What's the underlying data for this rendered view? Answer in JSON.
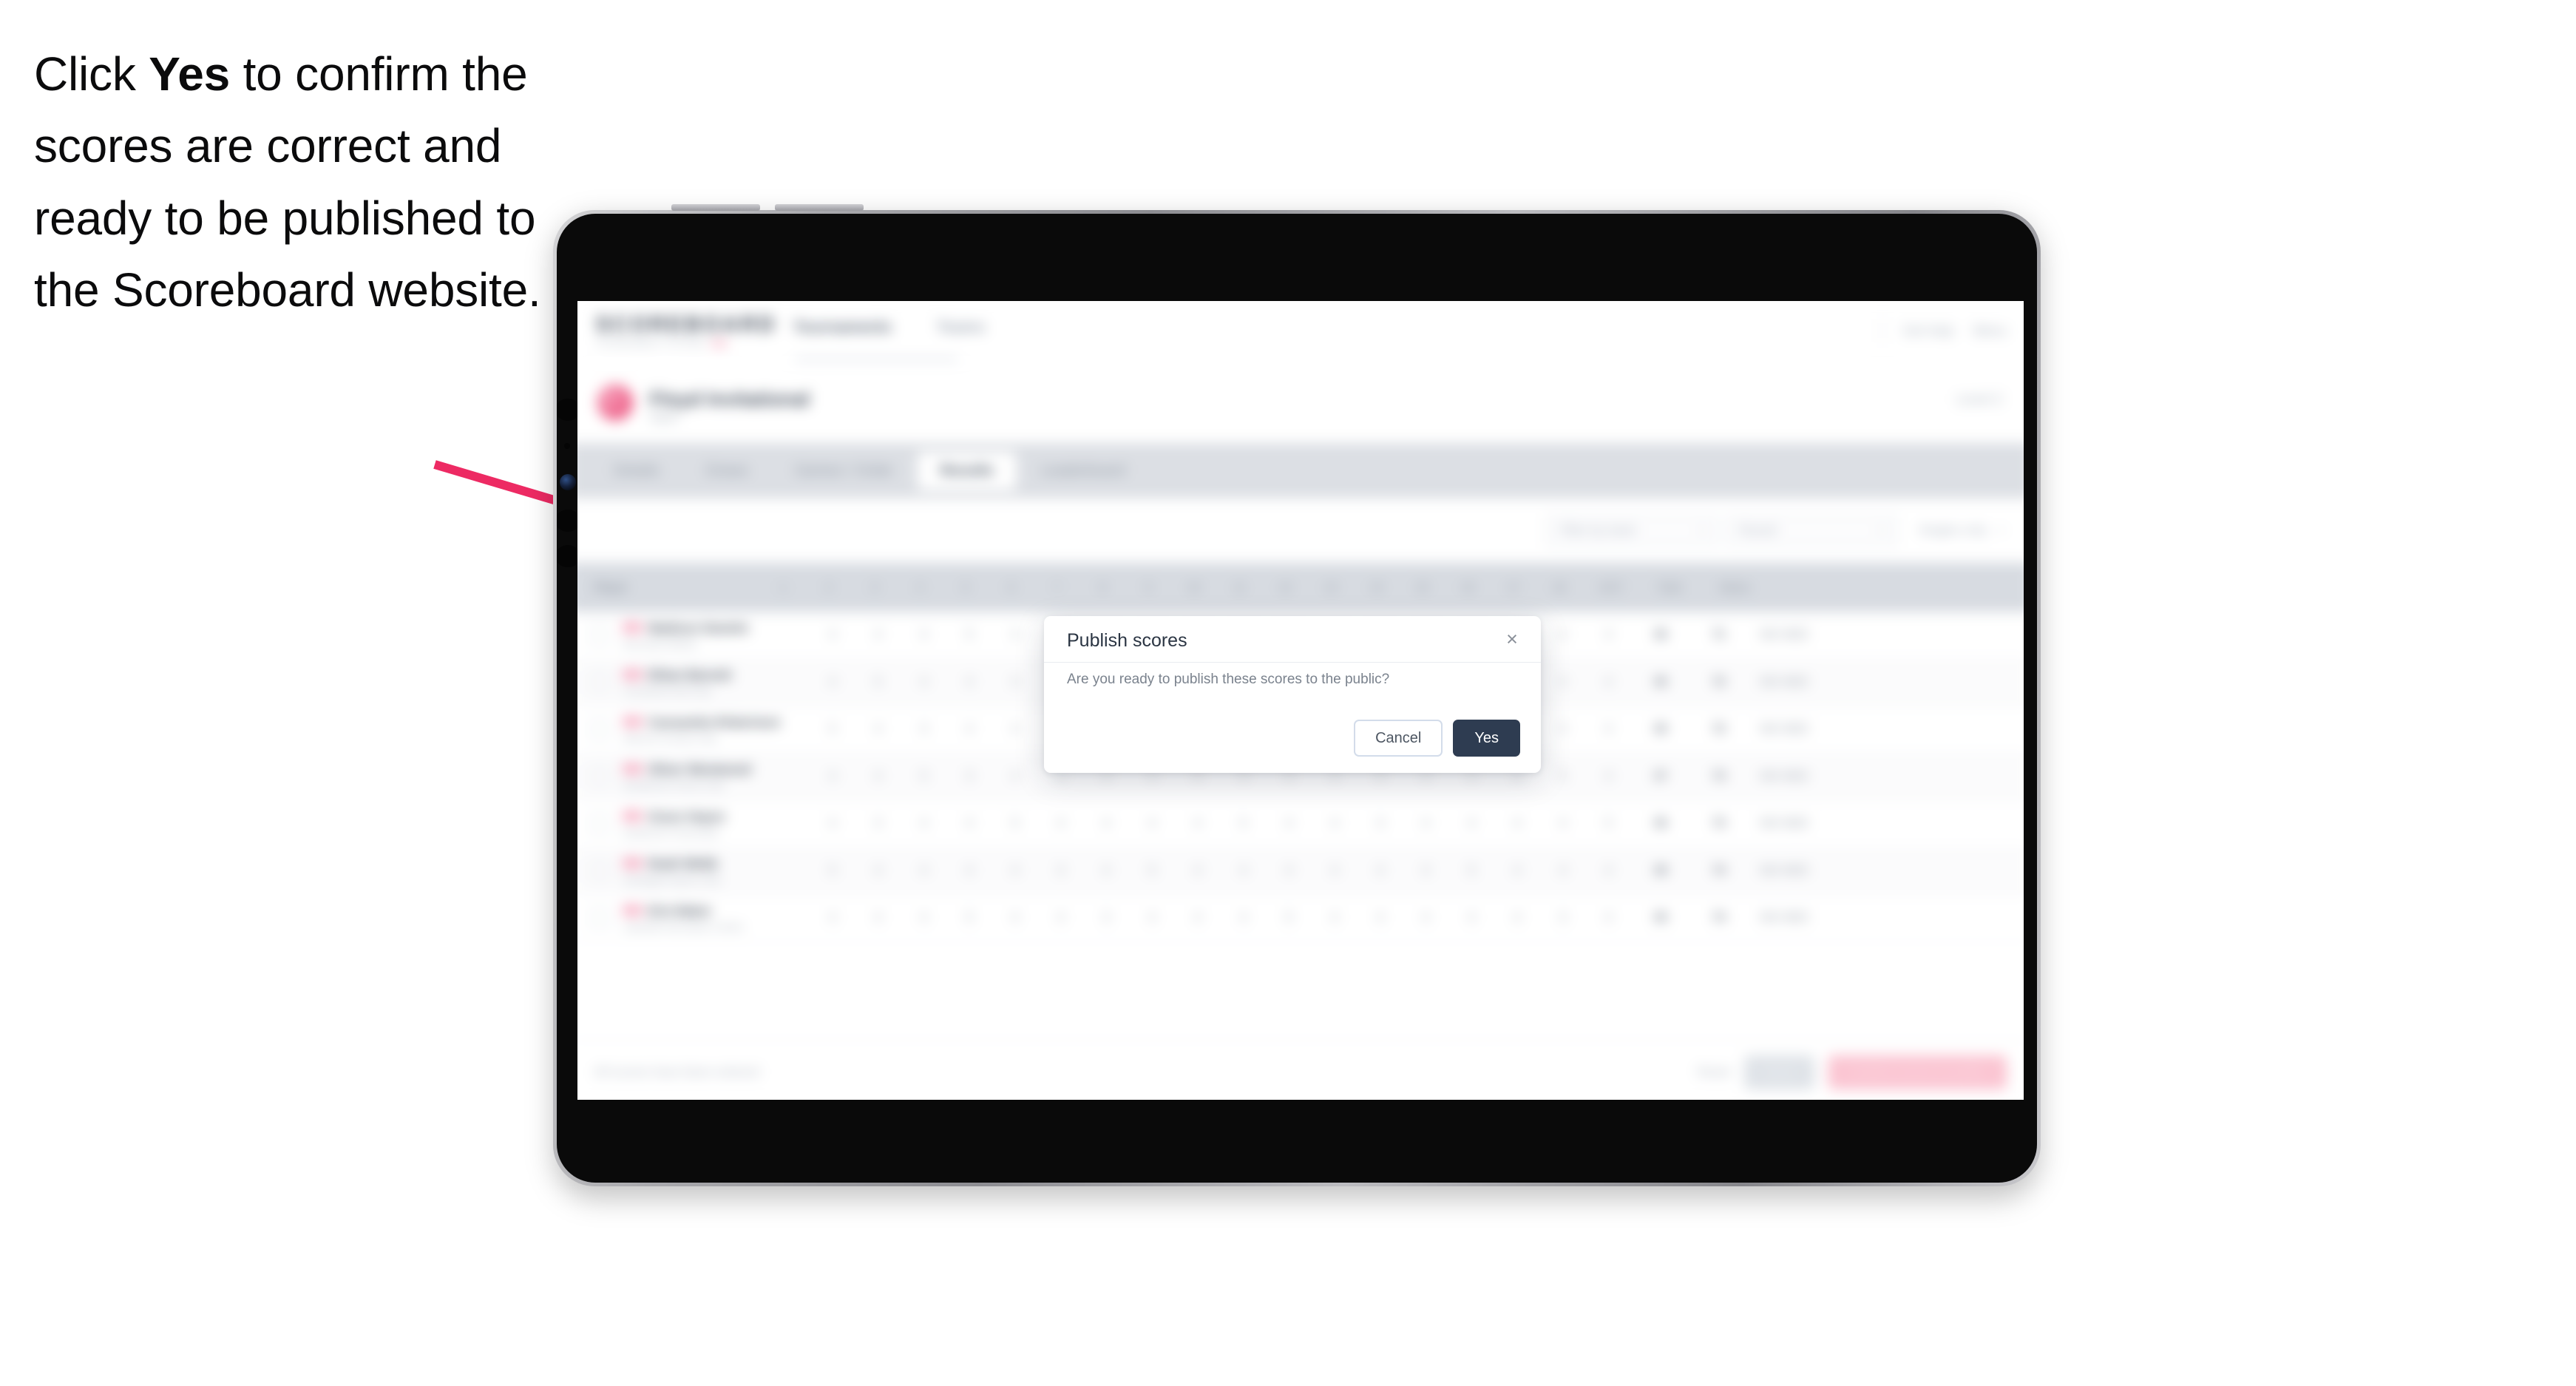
{
  "caption": {
    "part1": "Click ",
    "emphasis": "Yes",
    "part2": " to confirm the scores are correct and ready to be published to the Scoreboard website."
  },
  "colors": {
    "arrow": "#ED2A63",
    "yes_button": "#2E3C51",
    "cancel_border": "#D3DCEA",
    "brand_accent": "#EA3C6D"
  },
  "modal": {
    "title": "Publish scores",
    "message": "Are you ready to publish these scores to the public?",
    "close_label": "×",
    "cancel_label": "Cancel",
    "yes_label": "Yes"
  },
  "app": {
    "brand": "SCOREBOARD",
    "brand_sub": "TOURNAMENT SYSTEM",
    "nav": [
      {
        "label": "Tournaments",
        "active": true
      },
      {
        "label": "Teams",
        "active": false
      }
    ],
    "header_right": [
      {
        "label": "Get help"
      },
      {
        "label": "Menu"
      }
    ],
    "event": {
      "name": "Floyd Invitational",
      "status": "Open",
      "subtitle": "",
      "meta": "Level 2"
    },
    "tabs": [
      {
        "label": "Details",
        "active": false
      },
      {
        "label": "Draws",
        "active": false
      },
      {
        "label": "Games / Order",
        "active": false
      },
      {
        "label": "Results",
        "active": true
      },
      {
        "label": "Leaderboard",
        "active": false
      }
    ],
    "filters": [
      {
        "label": "Filter by team",
        "type": "select"
      },
      {
        "label": "Round",
        "type": "select"
      },
      {
        "label": "Singles only",
        "type": "select"
      }
    ],
    "table": {
      "columns": [
        "Player",
        "1",
        "2",
        "3",
        "4",
        "5",
        "6",
        "7",
        "8",
        "9",
        "10",
        "11",
        "12",
        "13",
        "14",
        "15",
        "16",
        "17",
        "18",
        "OUT",
        "Total",
        "Status"
      ],
      "rows": [
        {
          "name": "Madison Daniels",
          "club": "Riverside Athletic",
          "scores": [
            "4",
            "4",
            "4",
            "5",
            "4",
            "3",
            "4",
            "4",
            "4",
            "3",
            "5",
            "4",
            "3",
            "4",
            "4",
            "3",
            "4",
            "4"
          ],
          "out": "36",
          "total": "71",
          "status": "SIG  NED"
        },
        {
          "name": "Ethan Barnett",
          "club": "Crosswind Golf Club",
          "scores": [
            "4",
            "5",
            "4",
            "4",
            "3",
            "4",
            "4",
            "5",
            "4",
            "4",
            "4",
            "3",
            "4",
            "4",
            "5",
            "3",
            "4",
            "4"
          ],
          "out": "36",
          "total": "72",
          "status": "SIG  NED"
        },
        {
          "name": "Cassandra Robertson",
          "club": "Hillcrest Country Club",
          "scores": [
            "5",
            "4",
            "3",
            "4",
            "4",
            "4",
            "5",
            "4",
            "3",
            "4",
            "4",
            "4",
            "4",
            "5",
            "4",
            "4",
            "3",
            "4"
          ],
          "out": "36",
          "total": "72",
          "status": "SIG  NED"
        },
        {
          "name": "Oliver Westwood",
          "club": "Northbrook Tennis Club",
          "scores": [
            "4",
            "4",
            "5",
            "3",
            "4",
            "4",
            "4",
            "4",
            "5",
            "4",
            "3",
            "4",
            "4",
            "4",
            "4",
            "3",
            "5",
            "4"
          ],
          "out": "37",
          "total": "73",
          "status": "SIG  NED"
        },
        {
          "name": "Grace Hayes",
          "club": "Eastbrook Community",
          "scores": [
            "4",
            "3",
            "4",
            "4",
            "5",
            "4",
            "4",
            "4",
            "4",
            "5",
            "4",
            "4",
            "3",
            "4",
            "4",
            "4",
            "4",
            "5"
          ],
          "out": "36",
          "total": "73",
          "status": "SIG  NED"
        },
        {
          "name": "Noah Webb",
          "club": "Southgate Sports Club",
          "scores": [
            "5",
            "4",
            "4",
            "4",
            "4",
            "3",
            "4",
            "5",
            "4",
            "4",
            "4",
            "4",
            "4",
            "3",
            "5",
            "4",
            "4",
            "4"
          ],
          "out": "38",
          "total": "74",
          "status": "SIG  NED"
        },
        {
          "name": "Erin Baker",
          "club": "Lakeside Recreation Centre",
          "scores": [
            "4",
            "4",
            "4",
            "5",
            "4",
            "4",
            "3",
            "4",
            "4",
            "4",
            "5",
            "4",
            "4",
            "4",
            "4",
            "4",
            "3",
            "4"
          ],
          "out": "36",
          "total": "74",
          "status": "SIG  NED"
        }
      ]
    },
    "footer": {
      "note": "All scores have been entered",
      "link": "Reset",
      "secondary_button": "Save",
      "primary_button": "Publish scores to public"
    }
  }
}
